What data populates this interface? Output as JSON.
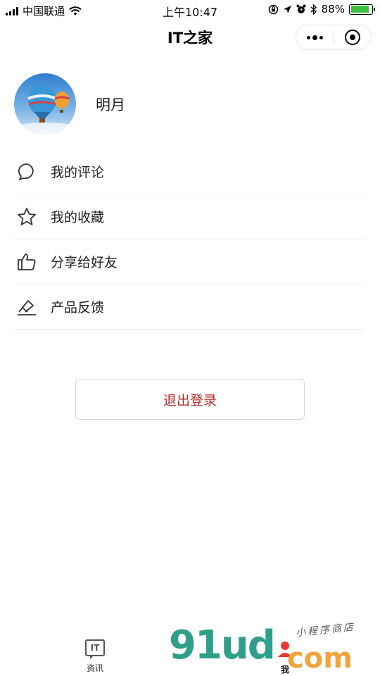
{
  "status_bar": {
    "carrier": "中国联通",
    "time": "上午10:47",
    "battery": "88%",
    "battery_level": 0.88
  },
  "nav": {
    "title": "IT之家"
  },
  "profile": {
    "name": "明月"
  },
  "menu": [
    {
      "label": "我的评论",
      "icon": "comment-icon"
    },
    {
      "label": "我的收藏",
      "icon": "star-icon"
    },
    {
      "label": "分享给好友",
      "icon": "thumbs-up-icon"
    },
    {
      "label": "产品反馈",
      "icon": "feedback-icon"
    }
  ],
  "logout_label": "退出登录",
  "tabs": [
    {
      "label": "资讯",
      "icon": "it-news-icon"
    },
    {
      "label": "我",
      "icon": "user-icon"
    }
  ],
  "watermark": {
    "brand": "91ud",
    "domain": "com",
    "tagline": "小程序商店"
  },
  "colors": {
    "logout_text": "#b52b2b",
    "battery_fill": "#3fbf3f"
  }
}
